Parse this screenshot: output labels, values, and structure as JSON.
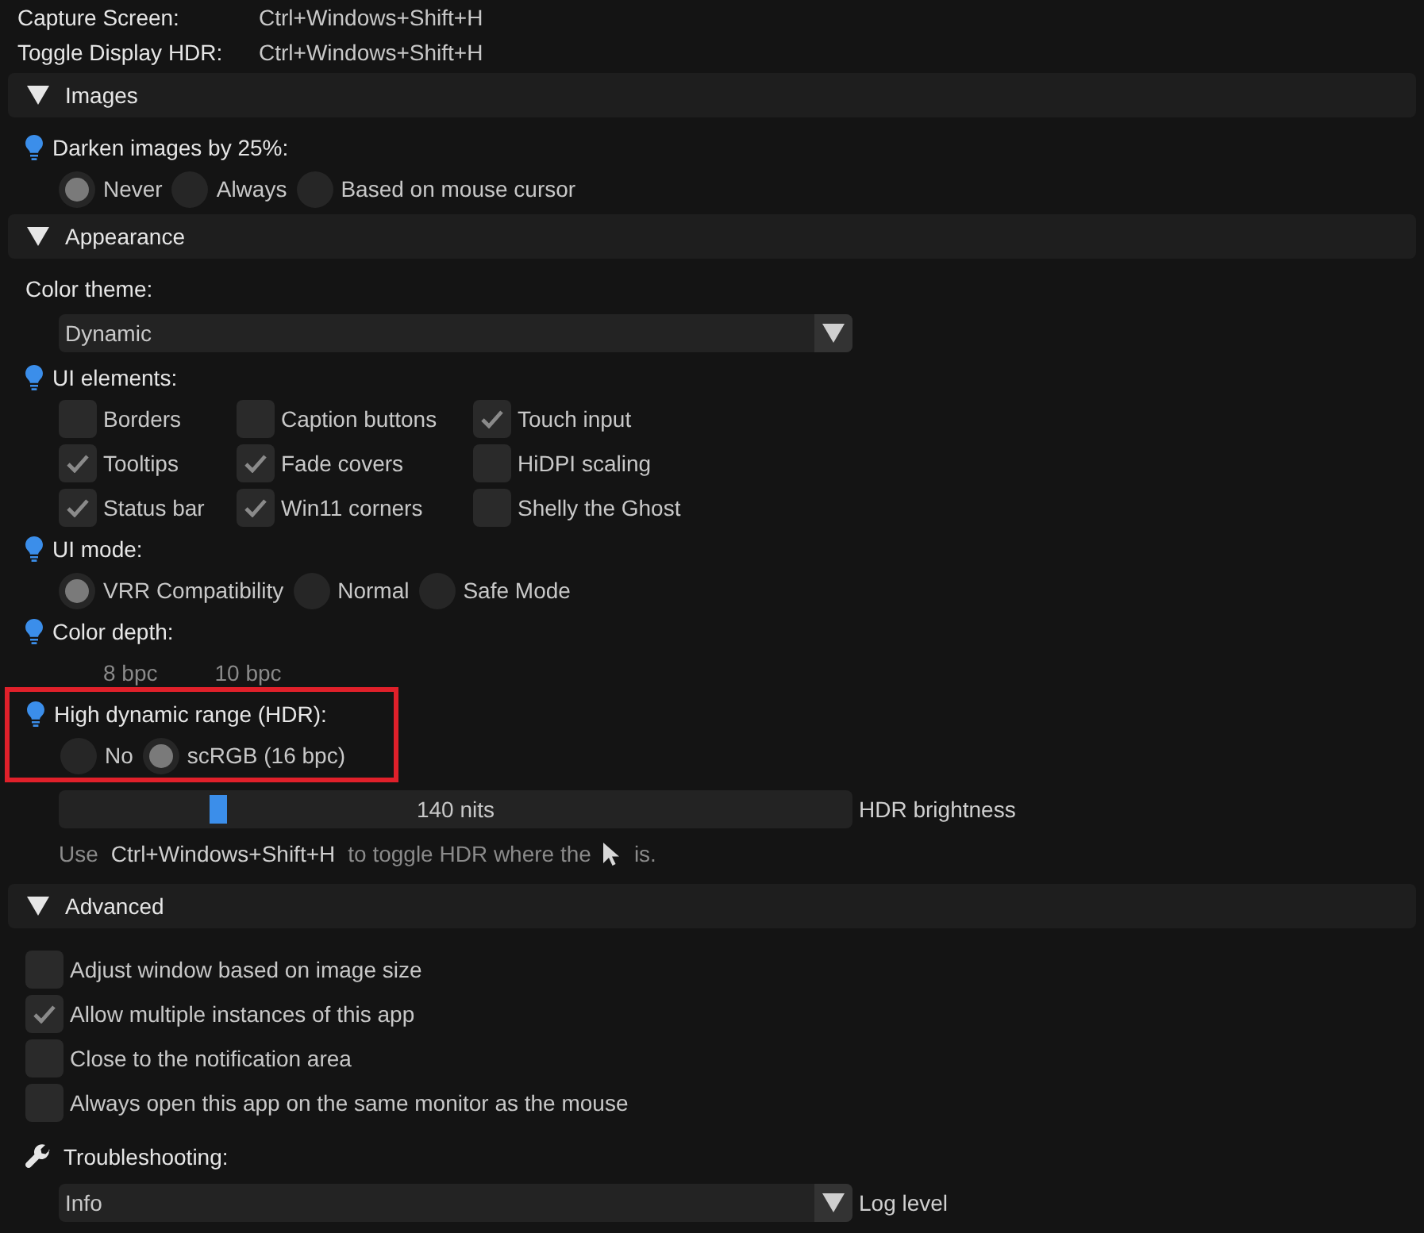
{
  "shortcuts": [
    {
      "label": "Capture Screen:",
      "keys": "Ctrl+Windows+Shift+H"
    },
    {
      "label": "Toggle Display HDR:",
      "keys": "Ctrl+Windows+Shift+H"
    }
  ],
  "sections": [
    {
      "title": "Images",
      "expanded": true,
      "items": [
        {
          "kind": "radio",
          "label": "Darken images by 25%:",
          "tip": true,
          "options": [
            {
              "label": "Never",
              "selected": true
            },
            {
              "label": "Always",
              "selected": false
            },
            {
              "label": "Based on mouse cursor",
              "selected": false
            }
          ]
        }
      ]
    },
    {
      "title": "Appearance",
      "expanded": true,
      "items": [
        {
          "kind": "select",
          "label": "Color theme:",
          "tip": false,
          "value": "Dynamic"
        },
        {
          "kind": "checkgrid",
          "label": "UI elements:",
          "tip": true,
          "options": [
            {
              "label": "Borders",
              "checked": false
            },
            {
              "label": "Caption buttons",
              "checked": false
            },
            {
              "label": "Touch input",
              "checked": true
            },
            {
              "label": "Tooltips",
              "checked": true
            },
            {
              "label": "Fade covers",
              "checked": true
            },
            {
              "label": "HiDPI scaling",
              "checked": false
            },
            {
              "label": "Status bar",
              "checked": true
            },
            {
              "label": "Win11 corners",
              "checked": true
            },
            {
              "label": "Shelly the Ghost",
              "checked": false
            }
          ]
        },
        {
          "kind": "radio",
          "label": "UI mode:",
          "tip": true,
          "options": [
            {
              "label": "VRR Compatibility",
              "selected": true
            },
            {
              "label": "Normal",
              "selected": false
            },
            {
              "label": "Safe Mode",
              "selected": false
            }
          ]
        },
        {
          "kind": "plain",
          "label": "Color depth:",
          "tip": true,
          "options": [
            {
              "label": "8 bpc"
            },
            {
              "label": "10 bpc"
            }
          ]
        },
        {
          "kind": "radio",
          "label": "High dynamic range (HDR):",
          "tip": true,
          "highlighted": true,
          "options": [
            {
              "label": "No",
              "selected": false
            },
            {
              "label": "scRGB (16 bpc)",
              "selected": true
            }
          ]
        },
        {
          "kind": "slider",
          "value": "140 nits",
          "caption": "HDR brightness",
          "level": 0.19
        },
        {
          "kind": "hint",
          "before": "Use",
          "keys": "Ctrl+Windows+Shift+H",
          "middle": "to toggle HDR where the",
          "after": "is."
        }
      ]
    },
    {
      "title": "Advanced",
      "expanded": true,
      "items": [
        {
          "kind": "checklist",
          "options": [
            {
              "label": "Adjust window based on image size",
              "checked": false
            },
            {
              "label": "Allow multiple instances of this app",
              "checked": true
            },
            {
              "label": "Close to the notification area",
              "checked": false
            },
            {
              "label": "Always open this app on the same monitor as the mouse",
              "checked": false
            }
          ]
        },
        {
          "kind": "heading",
          "label": "Troubleshooting:"
        },
        {
          "kind": "select",
          "value": "Info",
          "caption": "Log level"
        }
      ]
    }
  ]
}
